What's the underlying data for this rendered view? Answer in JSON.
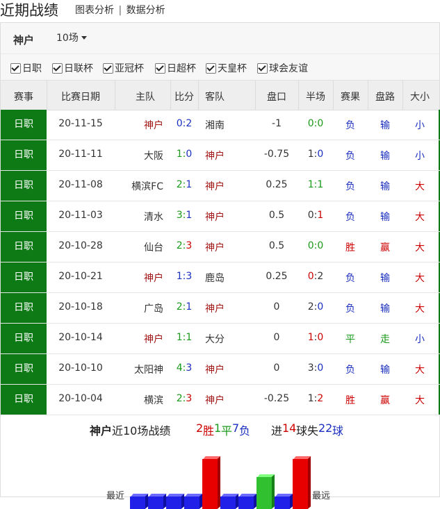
{
  "header": {
    "title": "近期战绩",
    "link_chart": "图表分析",
    "separator": "|",
    "link_data": "数据分析"
  },
  "team": {
    "name": "神户",
    "count_label": "10场"
  },
  "filters": [
    "日职",
    "日联杯",
    "亚冠杯",
    "日超杯",
    "天皇杯",
    "球会友谊"
  ],
  "columns": [
    "赛事",
    "比赛日期",
    "主队",
    "比分",
    "客队",
    "盘口",
    "半场",
    "赛果",
    "盘路",
    "大小"
  ],
  "colors": {
    "league_bg": "#0d7a16",
    "red": "#cc0000",
    "blue": "#1a2fbf",
    "green": "#1a9a1a",
    "team_red": "#a31414",
    "bar_red": "#e80000",
    "bar_blue": "#2020e8",
    "bar_green": "#30c030"
  },
  "matches": [
    {
      "league": "日职",
      "date": "20-11-15",
      "home": "神户",
      "home_is_team": true,
      "score_h": "0",
      "score_a": "2",
      "away": "湘南",
      "away_is_team": false,
      "handicap": "-1",
      "half_h": "0",
      "half_a": "0",
      "result": "负",
      "pan": "输",
      "ou": "小"
    },
    {
      "league": "日职",
      "date": "20-11-11",
      "home": "大阪",
      "home_is_team": false,
      "score_h": "1",
      "score_a": "0",
      "away": "神户",
      "away_is_team": true,
      "handicap": "-0.75",
      "half_h": "1",
      "half_a": "0",
      "result": "负",
      "pan": "输",
      "ou": "小"
    },
    {
      "league": "日职",
      "date": "20-11-08",
      "home": "横滨FC",
      "home_is_team": false,
      "score_h": "2",
      "score_a": "1",
      "away": "神户",
      "away_is_team": true,
      "handicap": "0.25",
      "half_h": "1",
      "half_a": "1",
      "result": "负",
      "pan": "输",
      "ou": "大"
    },
    {
      "league": "日职",
      "date": "20-11-03",
      "home": "清水",
      "home_is_team": false,
      "score_h": "3",
      "score_a": "1",
      "away": "神户",
      "away_is_team": true,
      "handicap": "0.5",
      "half_h": "0",
      "half_a": "1",
      "result": "负",
      "pan": "输",
      "ou": "大"
    },
    {
      "league": "日职",
      "date": "20-10-28",
      "home": "仙台",
      "home_is_team": false,
      "score_h": "2",
      "score_a": "3",
      "away": "神户",
      "away_is_team": true,
      "handicap": "0.5",
      "half_h": "0",
      "half_a": "0",
      "result": "胜",
      "pan": "赢",
      "ou": "大"
    },
    {
      "league": "日职",
      "date": "20-10-21",
      "home": "神户",
      "home_is_team": true,
      "score_h": "1",
      "score_a": "3",
      "away": "鹿岛",
      "away_is_team": false,
      "handicap": "0.25",
      "half_h": "0",
      "half_a": "2",
      "result": "负",
      "pan": "输",
      "ou": "大"
    },
    {
      "league": "日职",
      "date": "20-10-18",
      "home": "广岛",
      "home_is_team": false,
      "score_h": "2",
      "score_a": "1",
      "away": "神户",
      "away_is_team": true,
      "handicap": "0",
      "half_h": "2",
      "half_a": "0",
      "result": "负",
      "pan": "输",
      "ou": "大"
    },
    {
      "league": "日职",
      "date": "20-10-14",
      "home": "神户",
      "home_is_team": true,
      "score_h": "1",
      "score_a": "1",
      "away": "大分",
      "away_is_team": false,
      "handicap": "0",
      "half_h": "1",
      "half_a": "0",
      "result": "平",
      "pan": "走",
      "ou": "小"
    },
    {
      "league": "日职",
      "date": "20-10-10",
      "home": "太阳神",
      "home_is_team": false,
      "score_h": "4",
      "score_a": "3",
      "away": "神户",
      "away_is_team": true,
      "handicap": "0",
      "half_h": "3",
      "half_a": "0",
      "result": "负",
      "pan": "输",
      "ou": "大"
    },
    {
      "league": "日职",
      "date": "20-10-04",
      "home": "横滨",
      "home_is_team": false,
      "score_h": "2",
      "score_a": "3",
      "away": "神户",
      "away_is_team": true,
      "handicap": "-0.25",
      "half_h": "1",
      "half_a": "2",
      "result": "胜",
      "pan": "赢",
      "ou": "大"
    }
  ],
  "summary": {
    "team": "神户",
    "prefix": "近10场战绩",
    "wins": "2",
    "win_label": "胜",
    "draws": "1",
    "draw_label": "平",
    "losses": "7",
    "loss_label": "负",
    "goals_for_prefix": "进",
    "goals_for": "14",
    "goals_for_unit": "球失",
    "goals_against": "22",
    "goals_against_unit": "球"
  },
  "form_chart": {
    "label_left": "最近",
    "label_right": "最远",
    "results": [
      "负",
      "负",
      "负",
      "负",
      "胜",
      "负",
      "负",
      "平",
      "负",
      "胜"
    ]
  }
}
